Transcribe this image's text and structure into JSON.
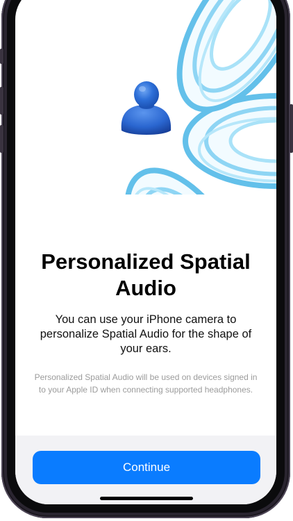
{
  "onboarding": {
    "title": "Personalized Spatial Audio",
    "description": "You can use your iPhone camera to personalize Spatial Audio for the shape of your ears.",
    "note": "Personalized Spatial Audio will be used on devices signed in to your Apple ID when connecting supported headphones.",
    "continue_label": "Continue"
  },
  "colors": {
    "accent": "#0a7cff",
    "figure": "#2a6fd6",
    "speaker_ring": "#6cc7ef",
    "background": "#ffffff",
    "bottom_panel": "#f2f2f5"
  },
  "illustration": {
    "center": "person-figure-icon",
    "surrounding": "speaker-icon"
  }
}
